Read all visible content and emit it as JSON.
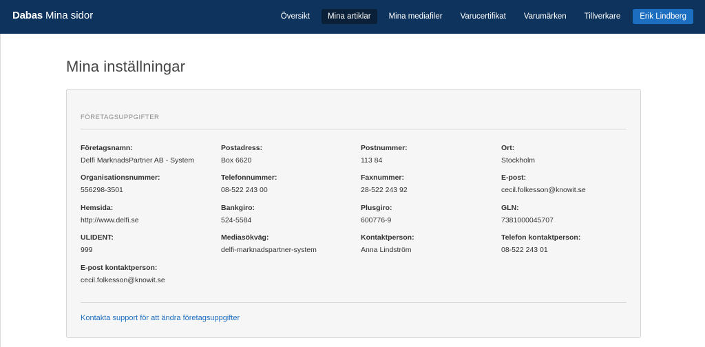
{
  "brand": {
    "name": "Dabas",
    "subtitle": "Mina sidor"
  },
  "nav": {
    "items": [
      {
        "label": "Översikt"
      },
      {
        "label": "Mina artiklar"
      },
      {
        "label": "Mina mediafiler"
      },
      {
        "label": "Varucertifikat"
      },
      {
        "label": "Varumärken"
      },
      {
        "label": "Tillverkare"
      }
    ],
    "active_index": 1,
    "user_label": "Erik Lindberg"
  },
  "page": {
    "title": "Mina inställningar"
  },
  "company": {
    "section_title": "FÖRETAGSUPPGIFTER",
    "fields": [
      {
        "label": "Företagsnamn:",
        "value": "Delfi MarknadsPartner AB - System"
      },
      {
        "label": "Postadress:",
        "value": "Box 6620"
      },
      {
        "label": "Postnummer:",
        "value": "113 84"
      },
      {
        "label": "Ort:",
        "value": "Stockholm"
      },
      {
        "label": "Organisationsnummer:",
        "value": "556298-3501"
      },
      {
        "label": "Telefonnummer:",
        "value": "08-522 243 00"
      },
      {
        "label": "Faxnummer:",
        "value": "28-522 243 92"
      },
      {
        "label": "E-post:",
        "value": "cecil.folkesson@knowit.se"
      },
      {
        "label": "Hemsida:",
        "value": "http://www.delfi.se"
      },
      {
        "label": "Bankgiro:",
        "value": "524-5584"
      },
      {
        "label": "Plusgiro:",
        "value": "600776-9"
      },
      {
        "label": "GLN:",
        "value": "7381000045707"
      },
      {
        "label": "ULIDENT:",
        "value": "999"
      },
      {
        "label": "Mediasökväg:",
        "value": "delfi-marknadspartner-system"
      },
      {
        "label": "Kontaktperson:",
        "value": "Anna Lindström"
      },
      {
        "label": "Telefon kontaktperson:",
        "value": "08-522 243 01"
      },
      {
        "label": "E-post kontaktperson:",
        "value": "cecil.folkesson@knowit.se"
      }
    ],
    "support_link": "Kontakta support för att ändra företagsuppgifter"
  }
}
